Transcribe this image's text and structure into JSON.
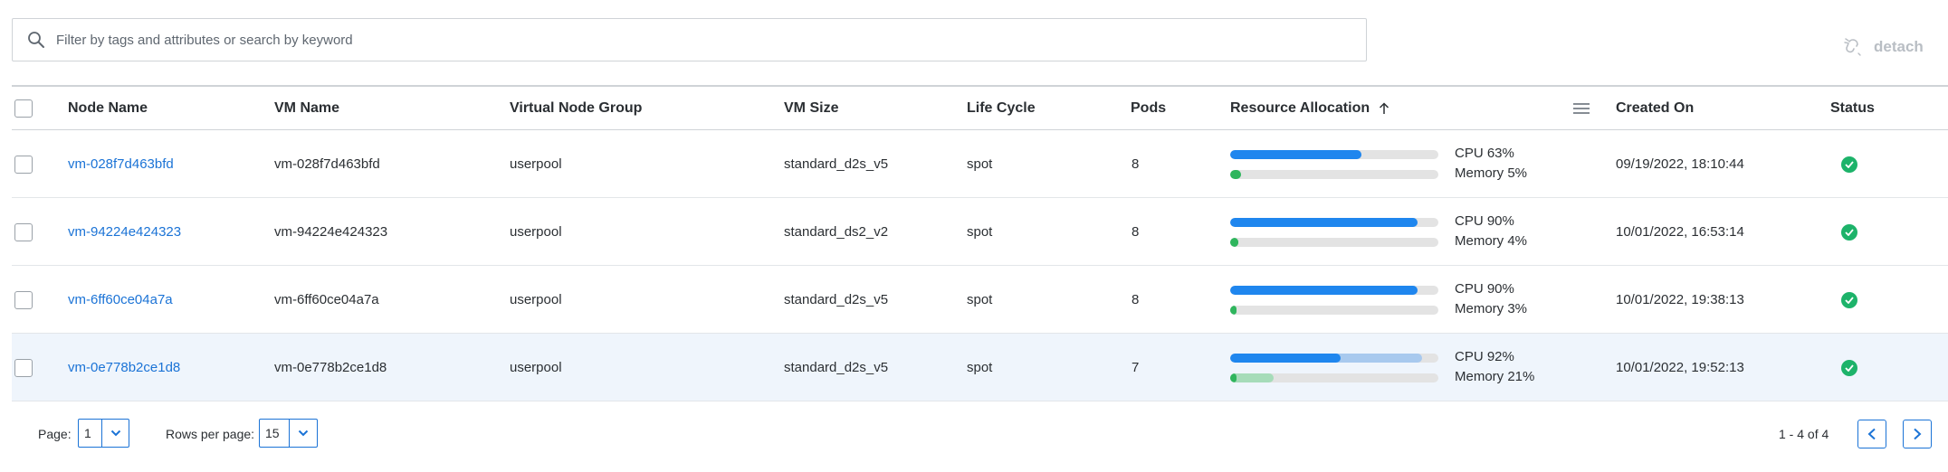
{
  "search": {
    "placeholder": "Filter by tags and attributes or search by keyword",
    "value": ""
  },
  "toolbar": {
    "detach_label": "detach"
  },
  "table": {
    "columns": {
      "node_name": "Node Name",
      "vm_name": "VM Name",
      "virtual_node_group": "Virtual Node Group",
      "vm_size": "VM Size",
      "life_cycle": "Life Cycle",
      "pods": "Pods",
      "resource_allocation": "Resource Allocation",
      "created_on": "Created On",
      "status": "Status"
    },
    "rows": [
      {
        "node_name": "vm-028f7d463bfd",
        "vm_name": "vm-028f7d463bfd",
        "group": "userpool",
        "vm_size": "standard_d2s_v5",
        "life_cycle": "spot",
        "pods": "8",
        "cpu_label": "CPU 63%",
        "mem_label": "Memory 5%",
        "cpu_used": 0.63,
        "cpu_pending": 0.63,
        "mem_used": 0.05,
        "mem_pending": 0.05,
        "created_on": "09/19/2022, 18:10:44",
        "status": "ok",
        "highlighted": false
      },
      {
        "node_name": "vm-94224e424323",
        "vm_name": "vm-94224e424323",
        "group": "userpool",
        "vm_size": "standard_ds2_v2",
        "life_cycle": "spot",
        "pods": "8",
        "cpu_label": "CPU 90%",
        "mem_label": "Memory 4%",
        "cpu_used": 0.9,
        "cpu_pending": 0.9,
        "mem_used": 0.04,
        "mem_pending": 0.04,
        "created_on": "10/01/2022, 16:53:14",
        "status": "ok",
        "highlighted": false
      },
      {
        "node_name": "vm-6ff60ce04a7a",
        "vm_name": "vm-6ff60ce04a7a",
        "group": "userpool",
        "vm_size": "standard_d2s_v5",
        "life_cycle": "spot",
        "pods": "8",
        "cpu_label": "CPU 90%",
        "mem_label": "Memory 3%",
        "cpu_used": 0.9,
        "cpu_pending": 0.9,
        "mem_used": 0.03,
        "mem_pending": 0.03,
        "created_on": "10/01/2022, 19:38:13",
        "status": "ok",
        "highlighted": false
      },
      {
        "node_name": "vm-0e778b2ce1d8",
        "vm_name": "vm-0e778b2ce1d8",
        "group": "userpool",
        "vm_size": "standard_d2s_v5",
        "life_cycle": "spot",
        "pods": "7",
        "cpu_label": "CPU 92%",
        "mem_label": "Memory 21%",
        "cpu_used": 0.53,
        "cpu_pending": 0.92,
        "mem_used": 0.03,
        "mem_pending": 0.21,
        "created_on": "10/01/2022, 19:52:13",
        "status": "ok",
        "highlighted": true
      }
    ]
  },
  "pagination": {
    "page_label": "Page:",
    "page_value": "1",
    "rows_label": "Rows per page:",
    "rows_value": "15",
    "range_text": "1 - 4 of 4"
  },
  "colors": {
    "link": "#1b73d6",
    "cpu_bar": "#1f86ee",
    "memory_bar": "#2fb55d",
    "status_ok": "#1db36a"
  },
  "icons": {
    "search": "search-icon",
    "detach": "detach-icon",
    "sort": "arrow-up-icon",
    "column_menu": "hamburger-menu-icon",
    "status": "check-circle-icon",
    "dropdown": "chevron-down-icon",
    "prev": "chevron-left-icon",
    "next": "chevron-right-icon"
  }
}
